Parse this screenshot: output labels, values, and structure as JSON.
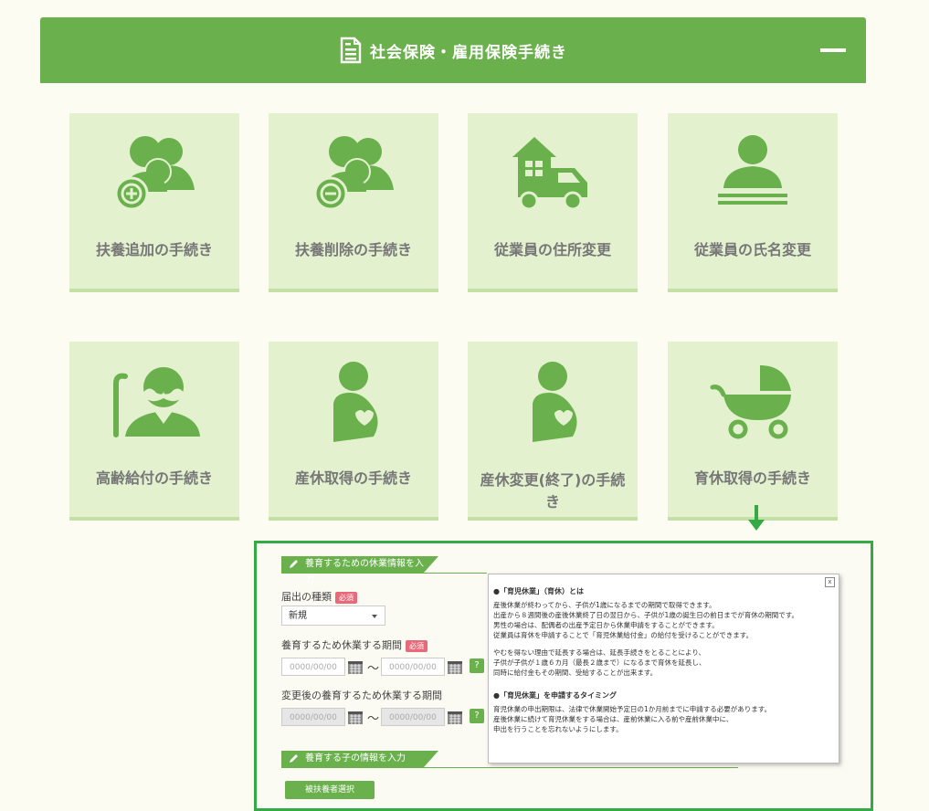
{
  "header": {
    "title": "社会保険・雇用保険手続き",
    "icon": "document-icon"
  },
  "tiles": [
    {
      "label": "扶養追加の手続き",
      "icon": "add-dependent-icon"
    },
    {
      "label": "扶養削除の手続き",
      "icon": "remove-dependent-icon"
    },
    {
      "label": "従業員の住所変更",
      "icon": "moving-truck-icon"
    },
    {
      "label": "従業員の氏名変更",
      "icon": "person-name-icon"
    },
    {
      "label": "高齢給付の手続き",
      "icon": "elderly-icon"
    },
    {
      "label": "産休取得の手続き",
      "icon": "pregnancy-icon"
    },
    {
      "label": "産休変更(終了)の手続き",
      "icon": "pregnancy-icon"
    },
    {
      "label": "育休取得の手続き",
      "icon": "baby-stroller-icon"
    }
  ],
  "form": {
    "section1": "養育するための休業情報を入力",
    "type_label": "届出の種類",
    "required": "必須",
    "type_value": "新規",
    "period_label": "養育するため休業する期間",
    "date_placeholder": "0000/00/00",
    "tilde": "〜",
    "help": "?",
    "changed_label": "変更後の養育するため休業する期間",
    "section2": "養育する子の情報を入力",
    "select_button": "被扶養者選択"
  },
  "tooltip": {
    "close": "x",
    "heading1": "●「育児休業」（育休）とは",
    "p1": [
      "産後休業が終わってから、子供が1歳になるまでの期間で取得できます。",
      "出産から８週間後の産後休業終了日の翌日から、子供が1歳の誕生日の前日までが育休の期間です。",
      "男性の場合は、配偶者の出産予定日から休業申請をすることができます。",
      "従業員は育休を申請することで「育児休業給付金」の給付を受けることができます。"
    ],
    "p2": [
      "やむを得ない理由で延長する場合は、延長手続きをとることにより、",
      "子供が子供が１歳６カ月（最長２歳まで）になるまで育休を延長し、",
      "同時に給付金もその期間、受給することが出来ます。"
    ],
    "heading2": "●「育児休業」を申請するタイミング",
    "p3": [
      "育児休業の申出期限は、法律で休業開始予定日の1か月前までに申請する必要があります。",
      "産後休業に続けて育児休業をする場合は、産前休業に入る前や産前休業中に、",
      "申出を行うことを忘れないようにします。"
    ]
  },
  "colors": {
    "accent": "#6ab04c",
    "tile_bg": "#e3f1cf",
    "panel_border": "#33aa44",
    "required_badge": "#e86a7a"
  }
}
